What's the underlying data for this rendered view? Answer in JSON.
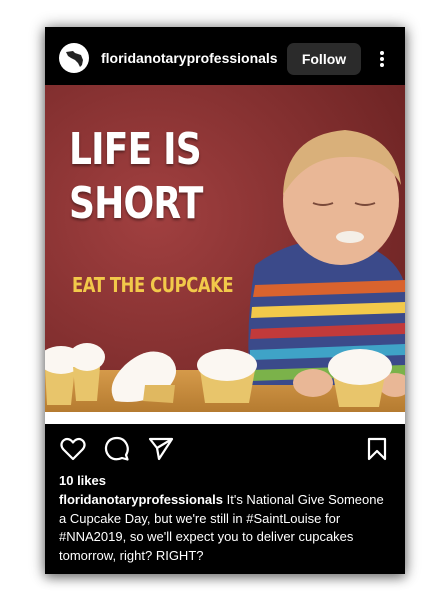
{
  "post": {
    "username": "floridanotaryprofessionals",
    "follow_label": "Follow",
    "image": {
      "headline_line1": "LIFE IS",
      "headline_line2": "SHORT",
      "tagline": "EAT THE CUPCAKE"
    },
    "likes": "10 likes",
    "caption_user": "floridanotaryprofessionals",
    "caption_text": "It's National Give Someone a Cupcake Day, but we're still in #SaintLouise for #NNA2019, so we'll expect you to deliver cupcakes tomorrow, right? RIGHT?"
  },
  "icons": {
    "more": "more-vertical-icon",
    "like": "heart-icon",
    "comment": "comment-icon",
    "share": "send-icon",
    "save": "bookmark-icon"
  },
  "colors": {
    "background": "#000000",
    "follow_button": "#2b2b2b",
    "text": "#ffffff",
    "tagline": "#f2c94a"
  }
}
